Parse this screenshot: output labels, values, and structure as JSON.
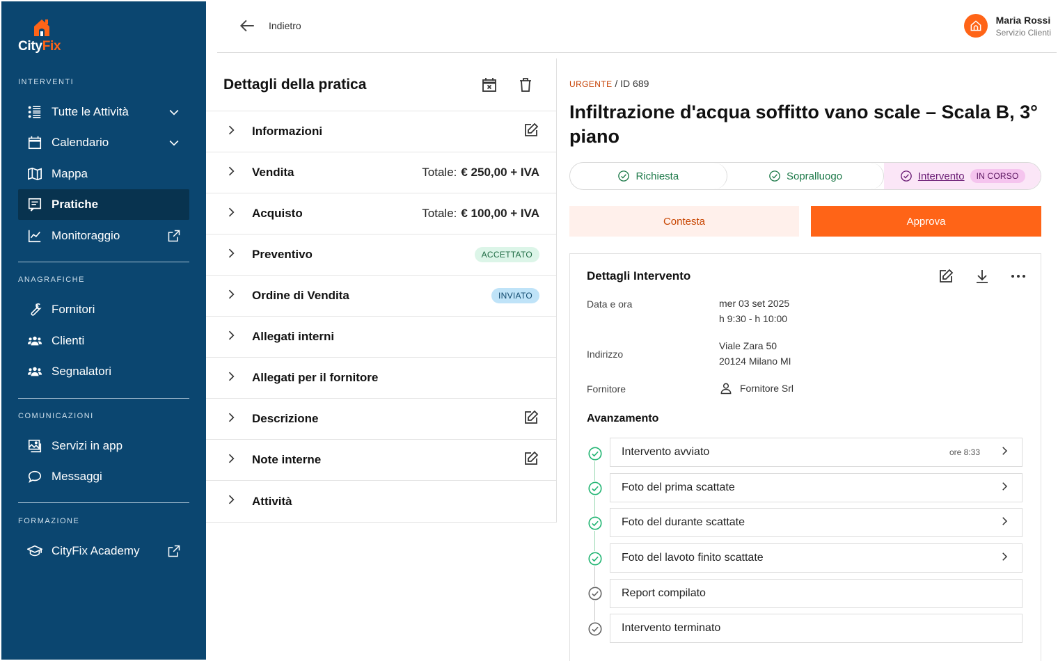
{
  "app": {
    "logo_text_a": "City",
    "logo_text_b": "Fix",
    "brand_color": "#ff6417",
    "sidebar_color": "#0b4670"
  },
  "sidebar": {
    "sections": {
      "interventi": "INTERVENTI",
      "anagrafiche": "ANAGRAFICHE",
      "comunicazioni": "COMUNICAZIONI",
      "formazione": "FORMAZIONE"
    },
    "items": [
      {
        "label": "Tutte le Attività",
        "icon": "list-icon"
      },
      {
        "label": "Calendario",
        "icon": "calendar-icon"
      },
      {
        "label": "Mappa",
        "icon": "map-icon"
      },
      {
        "label": "Pratiche",
        "icon": "file-text-icon",
        "active": true
      },
      {
        "label": "Monitoraggio",
        "icon": "chart-icon"
      },
      {
        "label": "Fornitori",
        "icon": "wrench-icon"
      },
      {
        "label": "Clienti",
        "icon": "users-icon"
      },
      {
        "label": "Segnalatori",
        "icon": "users-icon"
      },
      {
        "label": "Servizi in app",
        "icon": "image-icon"
      },
      {
        "label": "Messaggi",
        "icon": "chat-icon"
      },
      {
        "label": "CityFix Academy",
        "icon": "graduation-cap-icon"
      }
    ]
  },
  "topbar": {
    "back_label": "Indietro",
    "user_name": "Maria Rossi",
    "user_role": "Servizio Clienti"
  },
  "details": {
    "title": "Dettagli della pratica",
    "rows": [
      {
        "label": "Informazioni"
      },
      {
        "label": "Vendita",
        "total_label": "Totale:",
        "total_value": "€ 250,00 + IVA"
      },
      {
        "label": "Acquisto",
        "total_label": "Totale:",
        "total_value": "€ 100,00 + IVA"
      },
      {
        "label": "Preventivo",
        "badge": "ACCETTATO"
      },
      {
        "label": "Ordine di Vendita",
        "badge": "INVIATO"
      },
      {
        "label": "Allegati interni"
      },
      {
        "label": "Allegati per il fornitore"
      },
      {
        "label": "Descrizione"
      },
      {
        "label": "Note interne"
      },
      {
        "label": "Attività"
      }
    ]
  },
  "ticket": {
    "priority": "URGENTE",
    "id_label": "/ ID 689",
    "title": "Infiltrazione d'acqua soffitto vano scale – Scala B, 3° piano",
    "steps": [
      {
        "label": "Richiesta"
      },
      {
        "label": "Sopralluogo"
      },
      {
        "label": "Intervento",
        "status": "IN CORSO"
      }
    ],
    "contest_label": "Contesta",
    "approve_label": "Approva"
  },
  "intervention": {
    "title": "Dettagli Intervento",
    "date_label": "Data e ora",
    "date_line1": "mer 03 set 2025",
    "date_line2": "h 9:30 - h 10:00",
    "address_label": "Indirizzo",
    "address_line1": "Viale Zara 50",
    "address_line2": "20124 Milano MI",
    "supplier_label": "Fornitore",
    "supplier_value": "Fornitore Srl",
    "progress_title": "Avanzamento",
    "progress": [
      {
        "label": "Intervento avviato",
        "time": "ore 8:33",
        "done": true
      },
      {
        "label": "Foto del prima scattate",
        "done": true
      },
      {
        "label": "Foto del durante scattate",
        "done": true
      },
      {
        "label": "Foto del lavoto finito scattate",
        "done": true
      },
      {
        "label": "Report compilato",
        "done": false
      },
      {
        "label": "Intervento terminato",
        "done": false
      }
    ]
  }
}
